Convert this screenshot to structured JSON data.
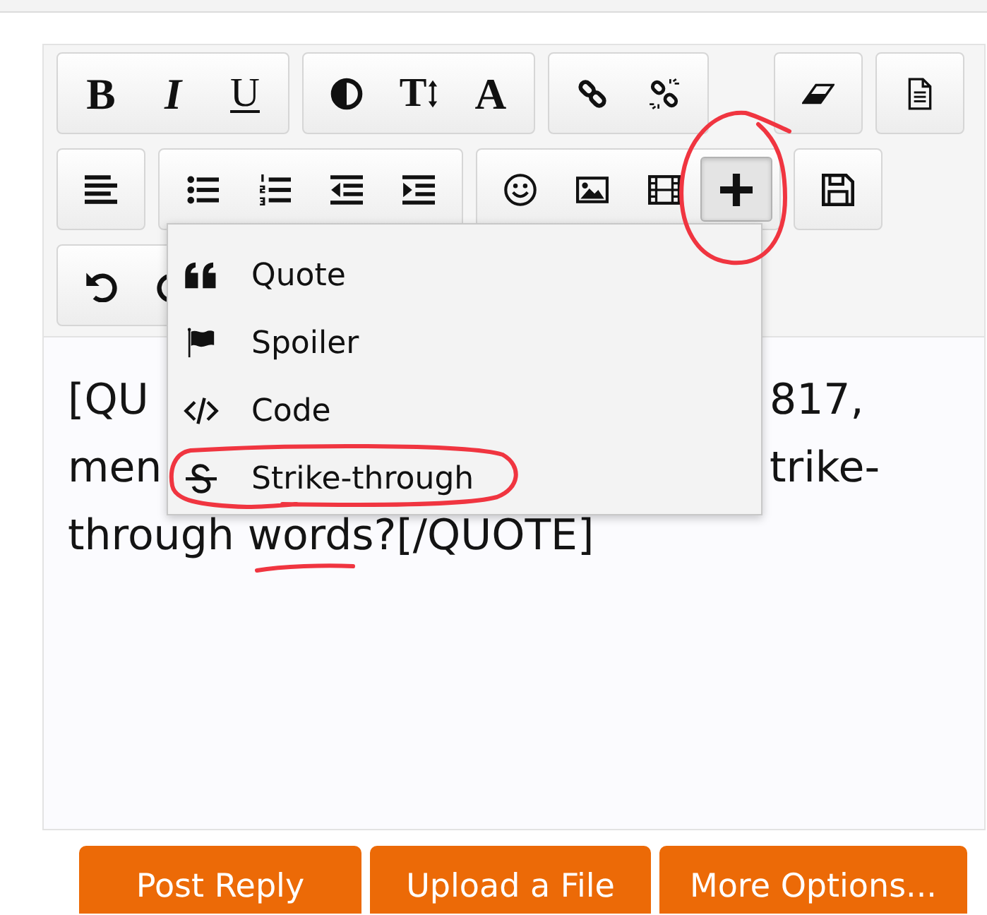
{
  "toolbar": {
    "rows": [
      {
        "groups": [
          {
            "buttons": [
              {
                "kind": "bold",
                "label": "B",
                "pressed": false
              },
              {
                "kind": "italic",
                "label": "I",
                "pressed": false
              },
              {
                "kind": "underline",
                "label": "U",
                "pressed": false
              }
            ]
          },
          {
            "buttons": [
              {
                "kind": "icon",
                "pressed": false
              },
              {
                "kind": "size",
                "label": "T",
                "pressed": false
              },
              {
                "kind": "color",
                "label": "A",
                "pressed": false
              }
            ]
          },
          {
            "buttons": [
              {
                "kind": "icon",
                "pressed": false
              },
              {
                "kind": "icon",
                "pressed": false
              }
            ]
          },
          {
            "buttons": [
              {
                "kind": "icon",
                "pressed": false
              }
            ]
          },
          {
            "buttons": [
              {
                "kind": "icon",
                "pressed": false
              }
            ]
          }
        ]
      },
      {
        "groups": [
          {
            "buttons": [
              {
                "kind": "icon",
                "pressed": false
              }
            ]
          },
          {
            "buttons": [
              {
                "kind": "icon",
                "pressed": false
              },
              {
                "kind": "icon",
                "pressed": false
              },
              {
                "kind": "icon",
                "pressed": false
              },
              {
                "kind": "icon",
                "pressed": false
              }
            ]
          },
          {
            "buttons": [
              {
                "kind": "icon",
                "pressed": false
              },
              {
                "kind": "icon",
                "pressed": false
              },
              {
                "kind": "icon",
                "pressed": false
              },
              {
                "kind": "icon",
                "pressed": true
              }
            ]
          },
          {
            "buttons": [
              {
                "kind": "icon",
                "pressed": false
              }
            ]
          }
        ]
      },
      {
        "groups": [
          {
            "buttons": [
              {
                "kind": "icon",
                "pressed": false
              },
              {
                "kind": "icon",
                "pressed": false
              }
            ]
          }
        ]
      }
    ]
  },
  "menu": {
    "items": [
      {
        "label": "Quote"
      },
      {
        "label": "Spoiler"
      },
      {
        "label": "Code"
      },
      {
        "label": "Strike-through"
      }
    ]
  },
  "editor": {
    "lines": [
      {
        "start": "[QU",
        "end": "817,"
      },
      {
        "start": "men",
        "end": "trike-"
      },
      {
        "start": "through words?[/QUOTE]"
      }
    ]
  },
  "buttons": [
    {
      "label": "Post Reply"
    },
    {
      "label": "Upload a File"
    },
    {
      "label": "More Options..."
    }
  ],
  "annotations": [
    {
      "kind": "circle"
    },
    {
      "kind": "loop"
    },
    {
      "kind": "underline"
    }
  ]
}
